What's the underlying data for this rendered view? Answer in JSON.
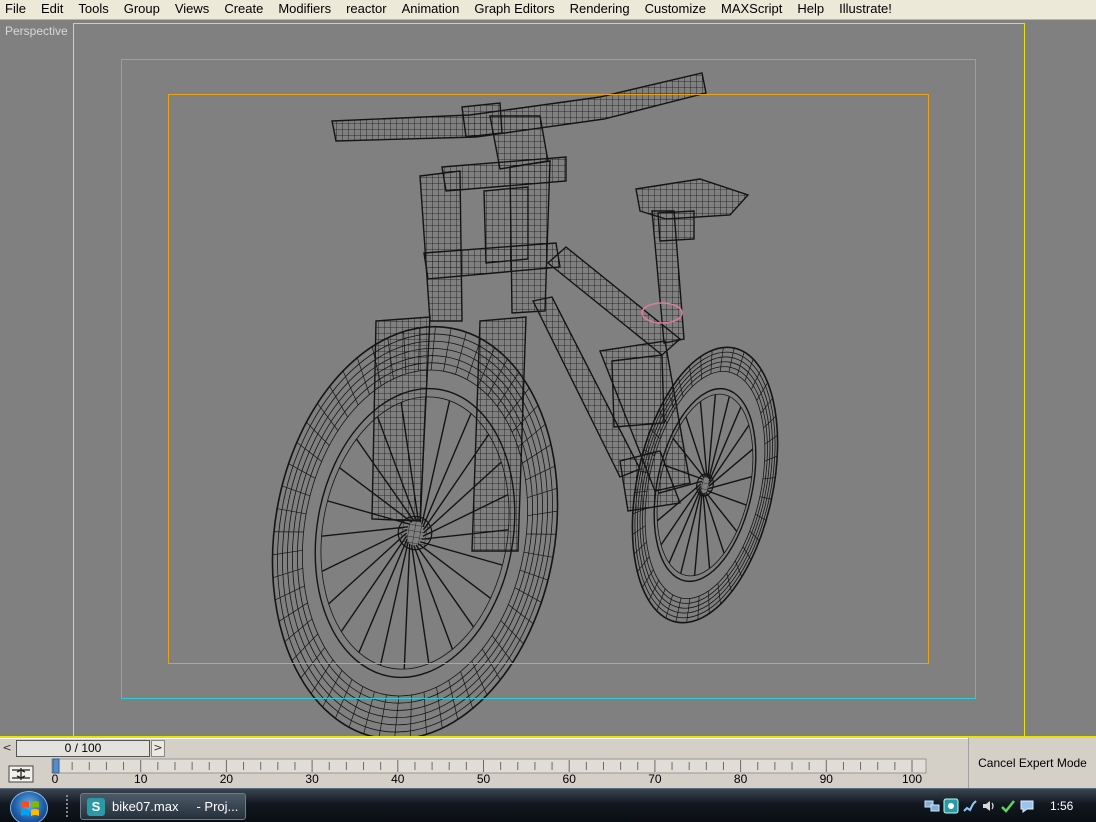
{
  "menubar": {
    "items": [
      "File",
      "Edit",
      "Tools",
      "Group",
      "Views",
      "Create",
      "Modifiers",
      "reactor",
      "Animation",
      "Graph Editors",
      "Rendering",
      "Customize",
      "MAXScript",
      "Help",
      "Illustrate!"
    ]
  },
  "viewport": {
    "label": "Perspective",
    "model": "mountain-bike-wireframe",
    "colors": {
      "background": "#808080",
      "frame_outer": "#e8e400",
      "frame_safe": "#2ecdd4",
      "frame_title": "#e6a31a",
      "wire": "#141414",
      "selection": "#e07a9a"
    }
  },
  "timeslider": {
    "prev_label": "<",
    "next_label": ">",
    "frame_label": "0 / 100",
    "current_frame": 0,
    "total_frames": 100
  },
  "trackbar": {
    "tick_labels": [
      "0",
      "10",
      "20",
      "30",
      "40",
      "50",
      "60",
      "70",
      "80",
      "90",
      "100"
    ]
  },
  "expert_mode": {
    "cancel_label": "Cancel Expert Mode"
  },
  "taskbar": {
    "task_title": "bike07.max",
    "task_second": "- Proj...",
    "clock": "1:56",
    "tray_icons": [
      "network-icon",
      "app-tray-icon",
      "network-wireless-icon",
      "volume-icon",
      "security-check-icon",
      "chat-icon"
    ]
  }
}
